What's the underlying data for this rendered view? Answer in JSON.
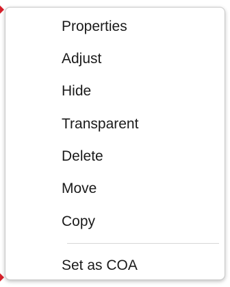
{
  "accent_color": "#d6202a",
  "context_menu": {
    "items": [
      {
        "label": "Properties"
      },
      {
        "label": "Adjust"
      },
      {
        "label": "Hide"
      },
      {
        "label": "Transparent"
      },
      {
        "label": "Delete"
      },
      {
        "label": "Move"
      },
      {
        "label": "Copy"
      },
      {
        "label": "Set as COA"
      }
    ]
  }
}
